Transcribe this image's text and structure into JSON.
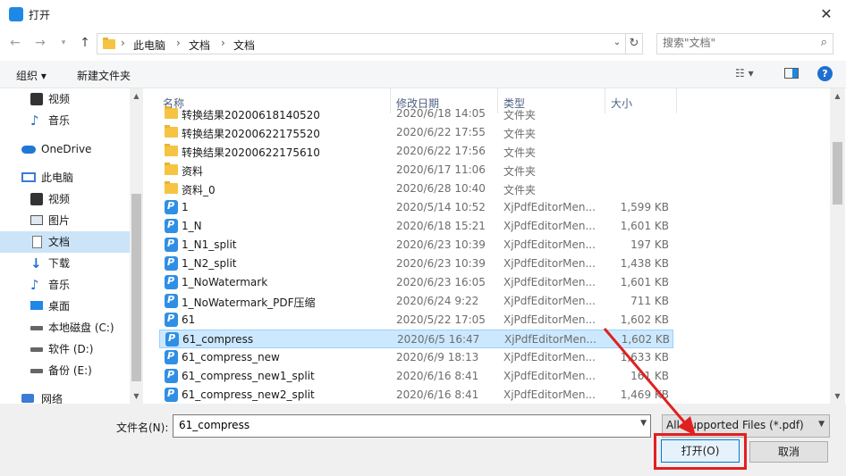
{
  "window": {
    "title": "打开",
    "close_glyph": "✕"
  },
  "address": {
    "crumbs": [
      "此电脑",
      "文档",
      "文档"
    ],
    "separator": "›",
    "dropdown_glyph": "⌄",
    "refresh_glyph": "↻"
  },
  "search": {
    "placeholder": "搜索\"文档\""
  },
  "toolbar": {
    "organize": "组织 ▾",
    "new_folder": "新建文件夹",
    "view_glyph": "☷ ▾",
    "help": "?"
  },
  "nav": {
    "items": [
      {
        "label": "视频",
        "icon": "video-icon"
      },
      {
        "label": "音乐",
        "icon": "music-icon"
      },
      {
        "label": "OneDrive",
        "icon": "cloud-icon"
      },
      {
        "label": "此电脑",
        "icon": "computer-icon"
      },
      {
        "label": "视频",
        "icon": "video-icon"
      },
      {
        "label": "图片",
        "icon": "picture-icon"
      },
      {
        "label": "文档",
        "icon": "document-icon"
      },
      {
        "label": "下载",
        "icon": "download-icon"
      },
      {
        "label": "音乐",
        "icon": "music-icon"
      },
      {
        "label": "桌面",
        "icon": "desktop-icon"
      },
      {
        "label": "本地磁盘 (C:)",
        "icon": "drive-icon"
      },
      {
        "label": "软件 (D:)",
        "icon": "drive-icon"
      },
      {
        "label": "备份 (E:)",
        "icon": "drive-icon"
      },
      {
        "label": "网络",
        "icon": "network-icon"
      }
    ]
  },
  "columns": {
    "name": "名称",
    "date": "修改日期",
    "type": "类型",
    "size": "大小"
  },
  "files": [
    {
      "name": "转换结果20200618140520",
      "date": "2020/6/18 14:05",
      "type": "文件夹",
      "size": "",
      "kind": "folder"
    },
    {
      "name": "转换结果20200622175520",
      "date": "2020/6/22 17:55",
      "type": "文件夹",
      "size": "",
      "kind": "folder"
    },
    {
      "name": "转换结果20200622175610",
      "date": "2020/6/22 17:56",
      "type": "文件夹",
      "size": "",
      "kind": "folder"
    },
    {
      "name": "资料",
      "date": "2020/6/17 11:06",
      "type": "文件夹",
      "size": "",
      "kind": "folder"
    },
    {
      "name": "资料_0",
      "date": "2020/6/28 10:40",
      "type": "文件夹",
      "size": "",
      "kind": "folder"
    },
    {
      "name": "1",
      "date": "2020/5/14 10:52",
      "type": "XjPdfEditorMen...",
      "size": "1,599 KB",
      "kind": "pdf"
    },
    {
      "name": "1_N",
      "date": "2020/6/18 15:21",
      "type": "XjPdfEditorMen...",
      "size": "1,601 KB",
      "kind": "pdf"
    },
    {
      "name": "1_N1_split",
      "date": "2020/6/23 10:39",
      "type": "XjPdfEditorMen...",
      "size": "197 KB",
      "kind": "pdf"
    },
    {
      "name": "1_N2_split",
      "date": "2020/6/23 10:39",
      "type": "XjPdfEditorMen...",
      "size": "1,438 KB",
      "kind": "pdf"
    },
    {
      "name": "1_NoWatermark",
      "date": "2020/6/23 16:05",
      "type": "XjPdfEditorMen...",
      "size": "1,601 KB",
      "kind": "pdf"
    },
    {
      "name": "1_NoWatermark_PDF压缩",
      "date": "2020/6/24 9:22",
      "type": "XjPdfEditorMen...",
      "size": "711 KB",
      "kind": "pdf"
    },
    {
      "name": "61",
      "date": "2020/5/22 17:05",
      "type": "XjPdfEditorMen...",
      "size": "1,602 KB",
      "kind": "pdf"
    },
    {
      "name": "61_compress",
      "date": "2020/6/5 16:47",
      "type": "XjPdfEditorMen...",
      "size": "1,602 KB",
      "kind": "pdf",
      "selected": true
    },
    {
      "name": "61_compress_new",
      "date": "2020/6/9 18:13",
      "type": "XjPdfEditorMen...",
      "size": "1,633 KB",
      "kind": "pdf"
    },
    {
      "name": "61_compress_new1_split",
      "date": "2020/6/16 8:41",
      "type": "XjPdfEditorMen...",
      "size": "161 KB",
      "kind": "pdf"
    },
    {
      "name": "61_compress_new2_split",
      "date": "2020/6/16 8:41",
      "type": "XjPdfEditorMen...",
      "size": "1,469 KB",
      "kind": "pdf"
    }
  ],
  "bottom": {
    "filename_label": "文件名(N):",
    "filename_value": "61_compress",
    "filetype": "All Supported Files (*.pdf)",
    "open_button": "打开(O)",
    "cancel_button": "取消"
  },
  "colors": {
    "accent": "#0078d7",
    "selection": "#cce8ff",
    "annotation": "#e02020",
    "pdf_icon": "#2f8fe4",
    "folder": "#f6c343"
  }
}
